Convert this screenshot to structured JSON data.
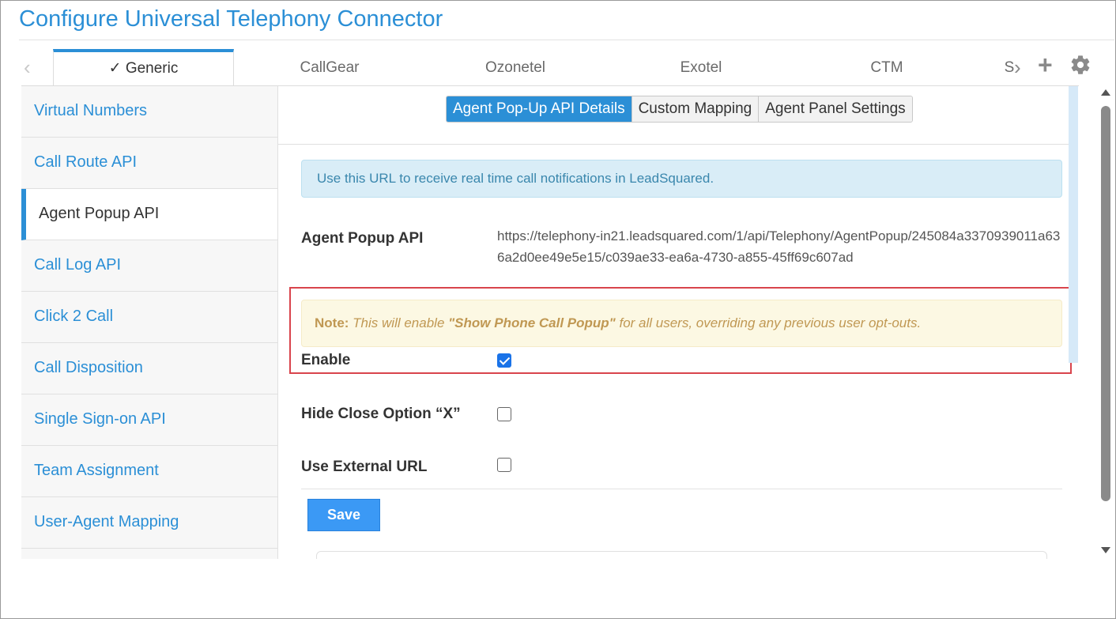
{
  "page": {
    "title": "Configure Universal Telephony Connector"
  },
  "top_tabs": [
    {
      "label": "✓ Generic",
      "active": true
    },
    {
      "label": "CallGear"
    },
    {
      "label": "Ozonetel"
    },
    {
      "label": "Exotel"
    },
    {
      "label": "CTM"
    },
    {
      "label": "S"
    }
  ],
  "top_nav": {
    "prev_icon": "chevron-left-icon",
    "next_icon": "chevron-right-icon",
    "add_icon": "plus-icon",
    "settings_icon": "gear-icon",
    "prev_glyph": "‹",
    "next_glyph": "›",
    "add_glyph": "+"
  },
  "sidebar": {
    "items": [
      {
        "label": "Virtual Numbers"
      },
      {
        "label": "Call Route API"
      },
      {
        "label": "Agent Popup API",
        "active": true
      },
      {
        "label": "Call Log API"
      },
      {
        "label": "Click 2 Call"
      },
      {
        "label": "Call Disposition"
      },
      {
        "label": "Single Sign-on API"
      },
      {
        "label": "Team Assignment"
      },
      {
        "label": "User-Agent Mapping"
      }
    ]
  },
  "subtabs": [
    {
      "label": "Agent Pop-Up API Details",
      "active": true
    },
    {
      "label": "Custom Mapping"
    },
    {
      "label": "Agent Panel Settings"
    }
  ],
  "info": {
    "text": "Use this URL to receive real time call notifications in LeadSquared."
  },
  "agent_popup_api": {
    "label": "Agent Popup API",
    "url": "https://telephony-in21.leadsquared.com/1/api/Telephony/AgentPopup/245084a3370939011a636a2d0ee49e5e15/c039ae33-ea6a-4730-a855-45ff69c607ad"
  },
  "note": {
    "prefix": "Note:",
    "text_before": " This will enable ",
    "emphasis": "\"Show Phone Call Popup\"",
    "text_after": " for all users, overriding any previous user opt-outs."
  },
  "fields": {
    "enable": {
      "label": "Enable",
      "checked": true
    },
    "hide_close": {
      "label": "Hide Close Option “X”",
      "checked": false
    },
    "external_url": {
      "label": "Use External URL",
      "checked": false
    }
  },
  "actions": {
    "save_label": "Save"
  },
  "colors": {
    "accent": "#2b8fd6",
    "highlight_border": "#d9444c",
    "info_bg": "#d9edf7",
    "note_bg": "#fcf8e3"
  }
}
